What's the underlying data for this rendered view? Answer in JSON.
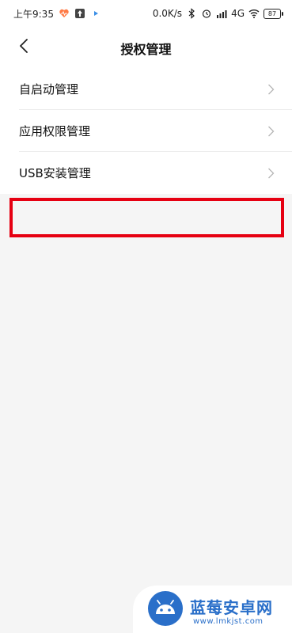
{
  "status_bar": {
    "time": "上午9:35",
    "net_speed": "0.0K/s",
    "network": "4G",
    "battery": "87"
  },
  "header": {
    "title": "授权管理"
  },
  "list": {
    "items": [
      {
        "label": "自启动管理"
      },
      {
        "label": "应用权限管理"
      },
      {
        "label": "USB安装管理"
      }
    ]
  },
  "watermark": {
    "title": "蓝莓安卓网",
    "url": "www.lmkjst.com"
  },
  "colors": {
    "highlight": "#e60012",
    "brand": "#2a6fc9"
  },
  "icons": {
    "back": "chevron-left-icon",
    "item_arrow": "chevron-right-icon"
  }
}
